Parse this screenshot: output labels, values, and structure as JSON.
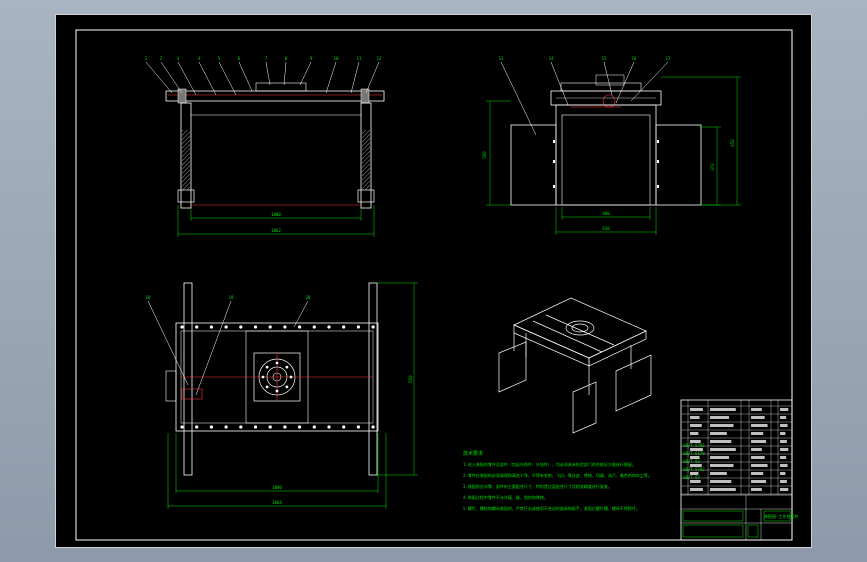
{
  "tech_requirements": {
    "title": "技术要求",
    "items": [
      "1.进入装配的零件及部件（包括外购件、外协件），均必须具有检验部门的合格证方能进行装配。",
      "2.零件在装配前必须清理和清洗干净，不得有毛刺、飞边、氧化皮、锈蚀、切屑、油污、着色剂和灰尘等。",
      "3.装配前应对零、部件的主要配合尺寸，特别是过盈配合尺寸及相关精度进行复查。",
      "4.装配过程中零件不允许磕、碰、划伤和锈蚀。",
      "5.螺钉、螺栓和螺母紧固时，严禁打击或使用不合适的旋具和扳手。紧固后螺钉槽、螺母不得损坏。"
    ]
  },
  "front_view": {
    "callouts": [
      "1",
      "2",
      "3",
      "4",
      "5",
      "6",
      "7",
      "8",
      "9",
      "10",
      "11",
      "12"
    ],
    "dim_inner": "1000",
    "dim_outer": "1062"
  },
  "side_view": {
    "callouts": [
      "13",
      "14",
      "15",
      "16",
      "17"
    ],
    "dim_left_height": "500",
    "dim_inner_height": "372",
    "dim_outer_height": "650",
    "dim_inner_width": "400",
    "dim_outer_width": "610"
  },
  "top_view": {
    "callouts": [
      "18",
      "19",
      "20"
    ],
    "dim_height": "650",
    "dim_width_inner": "1000",
    "dim_width_outer": "1064"
  },
  "title_block": {
    "drawing_label": "装配图-工作台组件",
    "row_codes": [
      "GB/T 5783",
      "GB/T 6170",
      "GB/T 93",
      "GB/T 5782",
      "GB/T 97"
    ]
  }
}
